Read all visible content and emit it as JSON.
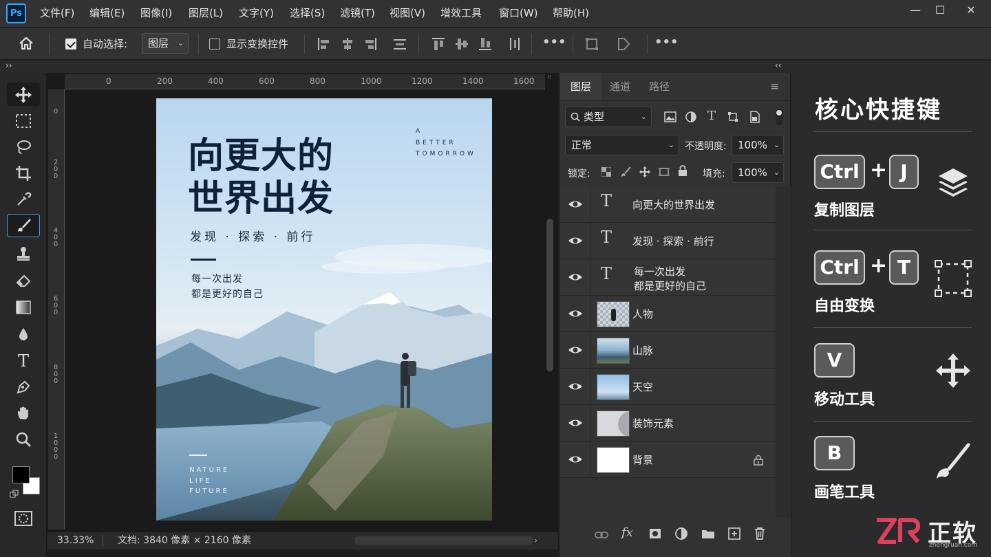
{
  "app": {
    "logo": "Ps"
  },
  "menu": [
    "文件(F)",
    "编辑(E)",
    "图像(I)",
    "图层(L)",
    "文字(Y)",
    "选择(S)",
    "滤镜(T)",
    "视图(V)",
    "增效工具",
    "窗口(W)",
    "帮助(H)"
  ],
  "window_controls": {
    "minimize": "—",
    "maximize": "☐",
    "close": "✕"
  },
  "options": {
    "auto_select_label": "自动选择:",
    "auto_select_checked": true,
    "auto_select_value": "图层",
    "show_transform_label": "显示变换控件",
    "show_transform_checked": false,
    "more": "•••"
  },
  "strip": {
    "left": "››",
    "right": "‹‹"
  },
  "ruler": {
    "top": [
      "0",
      "200",
      "400",
      "600",
      "800",
      "1000",
      "1200",
      "1400",
      "1600"
    ],
    "left": [
      "0",
      "200",
      "400",
      "600",
      "800",
      "1000"
    ]
  },
  "poster": {
    "title_line1": "向更大的",
    "title_line2": "世界出发",
    "subtitle": "发现 · 探索 · 前行",
    "body_line1": "每一次出发",
    "body_line2": "都是更好的自己",
    "tag_a": "A",
    "tag_b": "BETTER",
    "tag_c": "TOMORROW",
    "footer1": "NATURE",
    "footer2": "LIFE",
    "footer3": "FUTURE"
  },
  "status": {
    "zoom": "33.33%",
    "doc": "文档: 3840 像素 × 2160 像素"
  },
  "layers_panel": {
    "tabs": [
      "图层",
      "通道",
      "路径"
    ],
    "filter_label": "类型",
    "blend_mode": "正常",
    "opacity_label": "不透明度:",
    "opacity_value": "100%",
    "lock_label": "锁定:",
    "fill_label": "填充:",
    "fill_value": "100%",
    "layers": [
      {
        "name": "向更大的世界出发",
        "kind": "text"
      },
      {
        "name": "发现 · 探索 · 前行",
        "kind": "text"
      },
      {
        "name_line1": "每一次出发",
        "name_line2": "都是更好的自己",
        "kind": "text"
      },
      {
        "name": "人物",
        "kind": "image"
      },
      {
        "name": "山脉",
        "kind": "image"
      },
      {
        "name": "天空",
        "kind": "image"
      },
      {
        "name": "装饰元素",
        "kind": "image"
      },
      {
        "name": "背景",
        "kind": "image",
        "locked": true
      }
    ]
  },
  "shortcuts": {
    "title": "核心快捷键",
    "items": [
      {
        "keys": [
          "Ctrl",
          "J"
        ],
        "plus": "+",
        "label": "复制图层",
        "icon": "layers-stack-icon"
      },
      {
        "keys": [
          "Ctrl",
          "T"
        ],
        "plus": "+",
        "label": "自由变换",
        "icon": "transform-box-icon"
      },
      {
        "keys": [
          "V"
        ],
        "label": "移动工具",
        "icon": "move-icon"
      },
      {
        "keys": [
          "B"
        ],
        "label": "画笔工具",
        "icon": "brush-icon"
      }
    ]
  },
  "watermark": {
    "brand": "正软",
    "url": "zhengruan.com"
  },
  "colors": {
    "accent": "#31a8ff",
    "panel": "#323232",
    "watermark": "#e04060"
  }
}
